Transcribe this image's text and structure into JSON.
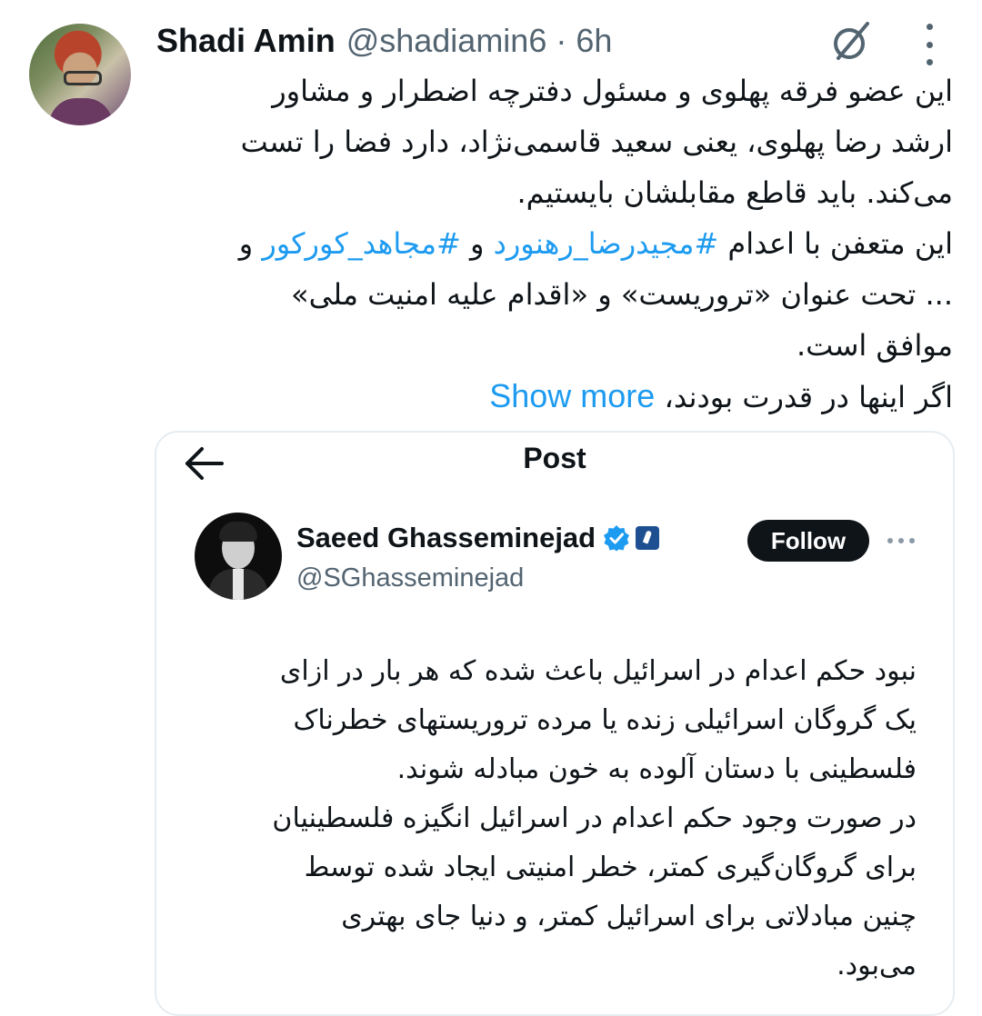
{
  "tweet": {
    "author_name": "Shadi Amin",
    "author_handle": "@shadiamin6",
    "separator": "·",
    "time": "6h",
    "lines": [
      "این عضو فرقه پهلوی و مسئول دفترچه اضطرار و مشاور",
      "ارشد رضا پهلوی، یعنی سعید قاسمی‌نژاد، دارد فضا را تست",
      "می‌کند. باید قاطع مقابلشان بایستیم."
    ],
    "line4_part1": "این متعفن با اعدام ",
    "hashtag1": "#مجیدرضا_رهنورد",
    "line4_part2": " و ",
    "hashtag2": "#مجاهد_کورکور",
    "line4_part3": " و",
    "line5": "... تحت عنوان «تروریست» و «اقدام علیه امنیت ملی»",
    "line6": "موافق است.",
    "line7": "اگر اینها در قدرت بودند، ",
    "show_more": "Show more"
  },
  "quoted_post": {
    "header_title": "Post",
    "author_name": "Saeed Ghasseminejad",
    "author_handle": "@SGhasseminejad",
    "follow_label": "Follow",
    "lines": [
      "نبود حکم اعدام در اسرائیل باعث شده که هر بار در ازای",
      "یک گروگان اسرائیلی زنده یا مرده  تروریستهای خطرناک",
      "فلسطینی با دستان آلوده به خون مبادله شوند.",
      "در صورت وجود حکم اعدام در اسرائیل انگیزه فلسطینیان",
      "برای گروگان‌گیری کمتر، خطر امنیتی ایجاد شده توسط",
      "چنین مبادلاتی برای اسرائیل کمتر، و دنیا جای بهتری",
      "می‌بود."
    ]
  },
  "colors": {
    "link": "#1d9bf0",
    "secondary_text": "#536471",
    "follow_bg": "#0f1419",
    "verified": "#1d9bf0"
  },
  "icons": {
    "grok": "grok-icon",
    "more": "more-vertical-icon",
    "back": "arrow-left-icon",
    "verified": "verified-badge-icon",
    "affiliate": "affiliate-badge-icon"
  }
}
